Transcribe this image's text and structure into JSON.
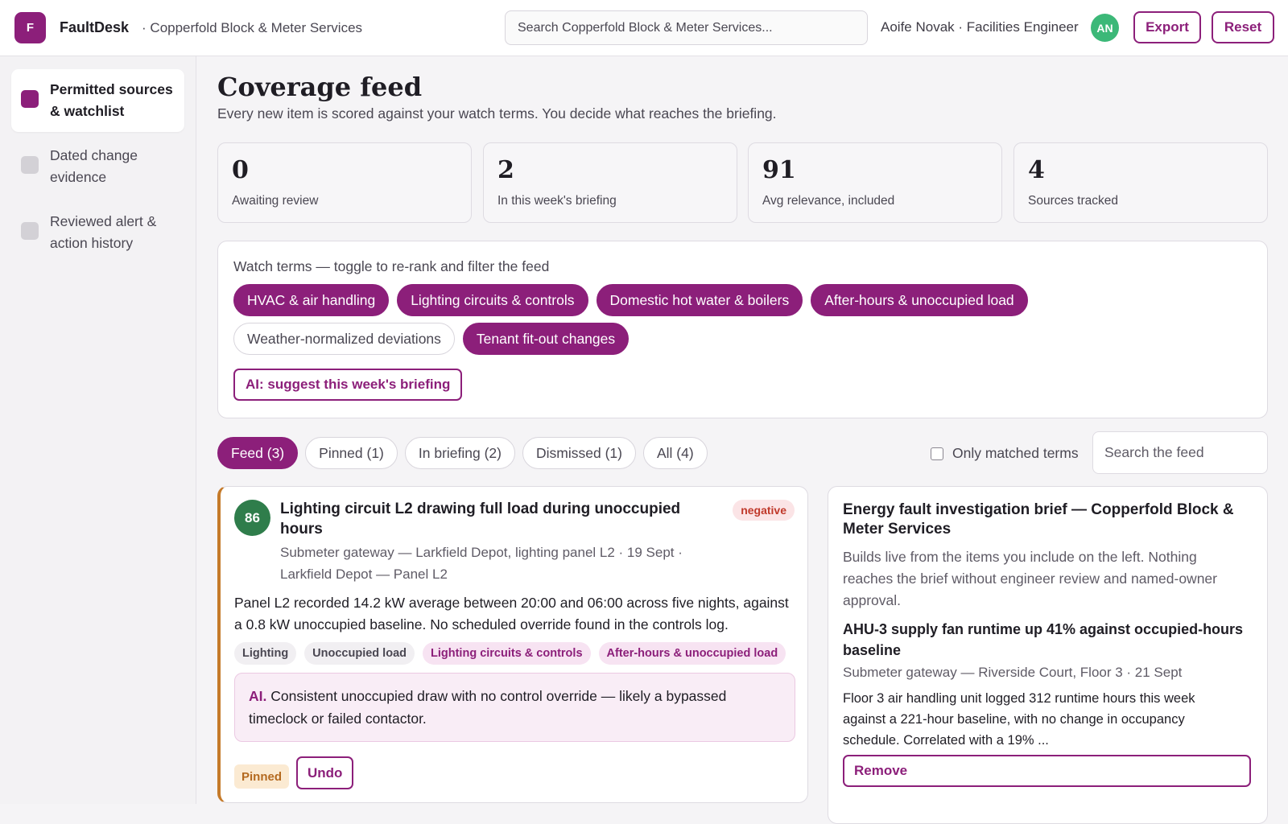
{
  "app": {
    "logo_letter": "F",
    "name": "FaultDesk",
    "org": "· Copperfold Block & Meter Services"
  },
  "search": {
    "placeholder": "Search Copperfold Block & Meter Services..."
  },
  "user": {
    "label": "Aoife Novak · Facilities Engineer",
    "initials": "AN"
  },
  "toolbar": {
    "export_label": "Export",
    "reset_label": "Reset"
  },
  "sidebar": {
    "items": [
      {
        "label": "Permitted sources & watchlist",
        "active": true
      },
      {
        "label": "Dated change evidence",
        "active": false
      },
      {
        "label": "Reviewed alert & action history",
        "active": false
      }
    ]
  },
  "page": {
    "title": "Coverage feed",
    "subtitle": "Every new item is scored against your watch terms. You decide what reaches the briefing."
  },
  "stats": [
    {
      "value": "0",
      "label": "Awaiting review"
    },
    {
      "value": "2",
      "label": "In this week's briefing"
    },
    {
      "value": "91",
      "label": "Avg relevance, included"
    },
    {
      "value": "4",
      "label": "Sources tracked"
    }
  ],
  "watch_terms": {
    "title": "Watch terms — toggle to re-rank and filter the feed",
    "terms": [
      {
        "label": "HVAC & air handling",
        "on": true
      },
      {
        "label": "Lighting circuits & controls",
        "on": true
      },
      {
        "label": "Domestic hot water & boilers",
        "on": true
      },
      {
        "label": "After-hours & unoccupied load",
        "on": true
      },
      {
        "label": "Weather-normalized deviations",
        "on": false
      },
      {
        "label": "Tenant fit-out changes",
        "on": true
      }
    ],
    "ai_button": "AI: suggest this week's briefing"
  },
  "tabs": [
    {
      "label": "Feed (3)",
      "active": true
    },
    {
      "label": "Pinned (1)",
      "active": false
    },
    {
      "label": "In briefing (2)",
      "active": false
    },
    {
      "label": "Dismissed (1)",
      "active": false
    },
    {
      "label": "All (4)",
      "active": false
    }
  ],
  "filters": {
    "only_matched_label": "Only matched terms",
    "feed_search_placeholder": "Search the feed"
  },
  "feed_item": {
    "score": "86",
    "title": "Lighting circuit L2 drawing full load during unoccupied hours",
    "sentiment": "negative",
    "meta": "Submeter gateway — Larkfield Depot, lighting panel L2 · 19 Sept · Larkfield Depot — Panel L2",
    "body": "Panel L2 recorded 14.2 kW average between 20:00 and 06:00 across five nights, against a 0.8 kW unoccupied baseline. No scheduled override found in the controls log.",
    "tags": [
      {
        "label": "Lighting",
        "matched": false
      },
      {
        "label": "Unoccupied load",
        "matched": false
      },
      {
        "label": "Lighting circuits & controls",
        "matched": true
      },
      {
        "label": "After-hours & unoccupied load",
        "matched": true
      }
    ],
    "ai_prefix": "AI.",
    "ai_text": "Consistent unoccupied draw with no control override — likely a bypassed timeclock or failed contactor.",
    "status": "Pinned",
    "undo_label": "Undo"
  },
  "brief": {
    "title": "Energy fault investigation brief — Copperfold Block & Meter Services",
    "subtitle": "Builds live from the items you include on the left. Nothing reaches the brief without engineer review and named-owner approval.",
    "item": {
      "title": "AHU-3 supply fan runtime up 41% against occupied-hours baseline",
      "meta": "Submeter gateway — Riverside Court, Floor 3 · 21 Sept",
      "body": "Floor 3 air handling unit logged 312 runtime hours this week against a 221-hour baseline, with no change in occupancy schedule. Correlated with a 19% ...",
      "remove_label": "Remove"
    }
  }
}
